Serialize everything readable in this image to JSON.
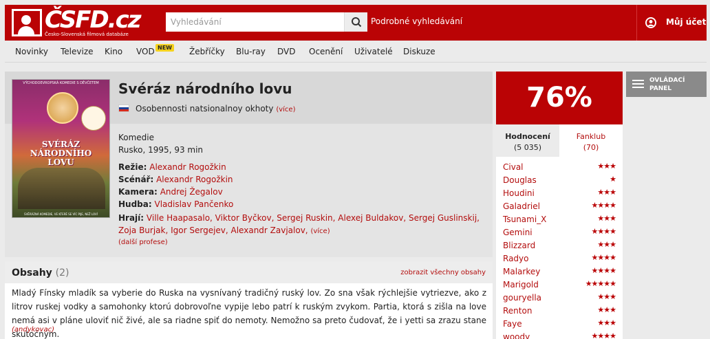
{
  "header": {
    "logo_text": "ČSFD.cz",
    "logo_subtitle": "Česko-Slovenská filmová databáze",
    "search_placeholder": "Vyhledávání",
    "advanced_search": "Podrobné vyhledávání",
    "account_label": "Můj účet",
    "brand_color": "#ba0305"
  },
  "nav": {
    "items": [
      "Novinky",
      "Televize",
      "Kino",
      "VOD",
      "Žebříčky",
      "Blu-ray",
      "DVD",
      "Ocenění",
      "Uživatelé",
      "Diskuze"
    ],
    "vod_badge": "NEW"
  },
  "film": {
    "title": "Svéráz národního lovu",
    "original_title": "Osobennosti natsionalnoy okhoty",
    "more_label": "(více)",
    "genre": "Komedie",
    "origin": "Rusko, 1995, 93 min",
    "poster": {
      "top_text": "VÝCHODOEVROPSKÁ KOMEDIE S DĚVČETEM",
      "title_line1": "SVÉRÁZ",
      "title_line2": "NÁRODNÍHO",
      "title_line3": "LOVU",
      "bottom_text": "SVĚRÁZNÁ KOMEDIE, VE KTERÉ SE VÍC PIJE, NEŽ LOVÍ"
    },
    "crew": {
      "director_label": "Režie:",
      "director": "Alexandr Rogožkin",
      "writer_label": "Scénář:",
      "writer": "Alexandr Rogožkin",
      "camera_label": "Kamera:",
      "camera": "Andrej Žegalov",
      "music_label": "Hudba:",
      "music": "Vladislav Pančenko",
      "cast_label": "Hrají:",
      "cast": "Ville Haapasalo, Viktor Byčkov, Sergej Ruskin, Alexej Buldakov, Sergej Guslinskij, Zoja Burjak, Igor Sergejev, Alexandr Zavjalov,",
      "cast_more": "(více)",
      "other_professions": "(další profese)"
    }
  },
  "plot": {
    "title": "Obsahy",
    "count": "(2)",
    "show_all": "zobrazit všechny obsahy",
    "text": "Mladý Fínsky mladík sa vyberie do Ruska na vysnívaný tradičný ruský lov. Zo sna však rýchlejšie vytriezve, ako z litrov ruskej vodky a samohonky ktorú dobrovoľne vypije lebo patrí k ruským zvykom. Partia, ktorá s zišla na love nemá asi v pláne uloviť nič živé, ale sa riadne spiť do nemoty. Nemožno sa preto čudovať, že i yetti sa zrazu stane skutočným.",
    "author": "(andykovac)"
  },
  "rating": {
    "percent": "76%",
    "tab_ratings": "Hodnocení",
    "tab_ratings_count": "(5 035)",
    "tab_fanclub": "Fanklub",
    "tab_fanclub_count": "(70)",
    "users": [
      {
        "name": "Cival",
        "stars": "★★★"
      },
      {
        "name": "Douglas",
        "stars": "★"
      },
      {
        "name": "Houdini",
        "stars": "★★★"
      },
      {
        "name": "Galadriel",
        "stars": "★★★★"
      },
      {
        "name": "Tsunami_X",
        "stars": "★★★"
      },
      {
        "name": "Gemini",
        "stars": "★★★★"
      },
      {
        "name": "Blizzard",
        "stars": "★★★"
      },
      {
        "name": "Radyo",
        "stars": "★★★★"
      },
      {
        "name": "Malarkey",
        "stars": "★★★★"
      },
      {
        "name": "Marigold",
        "stars": "★★★★★"
      },
      {
        "name": "gouryella",
        "stars": "★★★"
      },
      {
        "name": "Renton",
        "stars": "★★★"
      },
      {
        "name": "Faye",
        "stars": "★★★"
      },
      {
        "name": "woody",
        "stars": "★★★★"
      }
    ]
  },
  "control_panel": {
    "line1": "OVLÁDACÍ",
    "line2": "PANEL"
  }
}
